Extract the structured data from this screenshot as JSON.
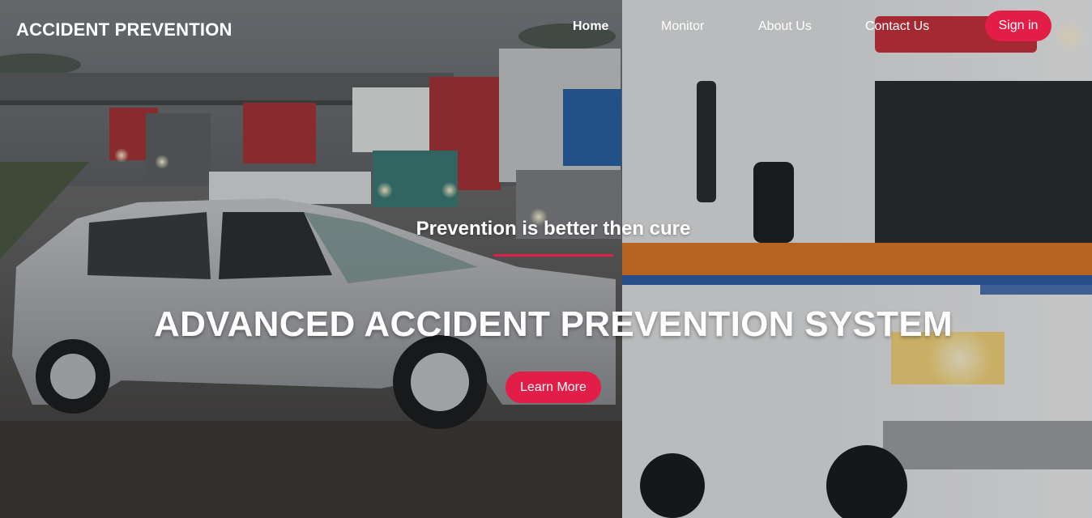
{
  "brand": {
    "title": "ACCIDENT PREVENTION"
  },
  "nav": {
    "items": [
      {
        "label": "Home",
        "active": true
      },
      {
        "label": "Monitor",
        "active": false
      },
      {
        "label": "About Us",
        "active": false
      },
      {
        "label": "Contact Us",
        "active": false
      }
    ],
    "signin_label": "Sign in"
  },
  "hero": {
    "tagline": "Prevention is better then cure",
    "headline": "ADVANCED ACCIDENT PREVENTION SYSTEM",
    "cta_label": "Learn More",
    "background_image": "highway accident scene with damaged silver car, trucks and ambulance"
  },
  "colors": {
    "accent": "#e11d48",
    "text": "#ffffff"
  }
}
